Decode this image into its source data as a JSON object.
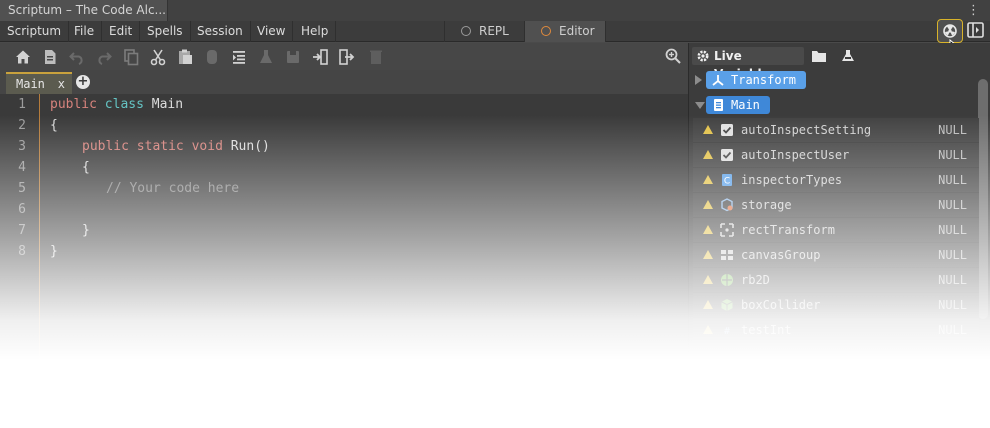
{
  "window": {
    "title": "Scriptum – The Code Alc...",
    "more_icon": "⋮"
  },
  "menu": {
    "items": [
      "Scriptum",
      "File",
      "Edit",
      "Spells",
      "Session",
      "View",
      "Help"
    ],
    "modes": [
      {
        "label": "REPL",
        "active": false
      },
      {
        "label": "Editor",
        "active": true
      }
    ],
    "accent_color": "#d8b32a"
  },
  "toolbar": {
    "icons": [
      "home-icon",
      "file-icon",
      "undo-icon",
      "redo-icon",
      "copy-icon",
      "cut-icon",
      "paste-icon",
      "snippet-icon",
      "indent-icon",
      "flask-icon",
      "save-icon",
      "import-icon",
      "export-icon",
      "trash-icon"
    ],
    "zoom_icon": "zoom-icon"
  },
  "editor": {
    "tab": {
      "label": "Main",
      "close": "x"
    },
    "line_numbers": [
      "1",
      "2",
      "3",
      "4",
      "5",
      "6",
      "7",
      "8"
    ],
    "code": {
      "l1": {
        "kw1": "public",
        "kw2": "class",
        "name": "Main"
      },
      "l2": "{",
      "l3": {
        "kw1": "public",
        "kw2": "static",
        "kw3": "void",
        "name": "Run()"
      },
      "l4": "{",
      "l5": "// Your code here",
      "l7": "}",
      "l8": "}"
    }
  },
  "live_variables": {
    "title": "Live Variables",
    "header_icons": [
      "gear-icon",
      "folder-icon",
      "flask-icon"
    ],
    "nodes": [
      {
        "label": "Transform",
        "expanded": false
      },
      {
        "label": "Main",
        "expanded": true
      }
    ],
    "rows": [
      {
        "name": "autoInspectSetting",
        "value": "NULL",
        "icon": "checkbox-icon"
      },
      {
        "name": "autoInspectUser",
        "value": "NULL",
        "icon": "checkbox-icon"
      },
      {
        "name": "inspectorTypes",
        "value": "NULL",
        "icon": "script-icon"
      },
      {
        "name": "storage",
        "value": "NULL",
        "icon": "storage-icon"
      },
      {
        "name": "rectTransform",
        "value": "NULL",
        "icon": "rect-transform-icon"
      },
      {
        "name": "canvasGroup",
        "value": "NULL",
        "icon": "canvas-group-icon"
      },
      {
        "name": "rb2D",
        "value": "NULL",
        "icon": "rigidbody-icon"
      },
      {
        "name": "boxCollider",
        "value": "NULL",
        "icon": "box-collider-icon"
      },
      {
        "name": "testInt",
        "value": "NULL",
        "icon": "number-icon"
      }
    ]
  }
}
